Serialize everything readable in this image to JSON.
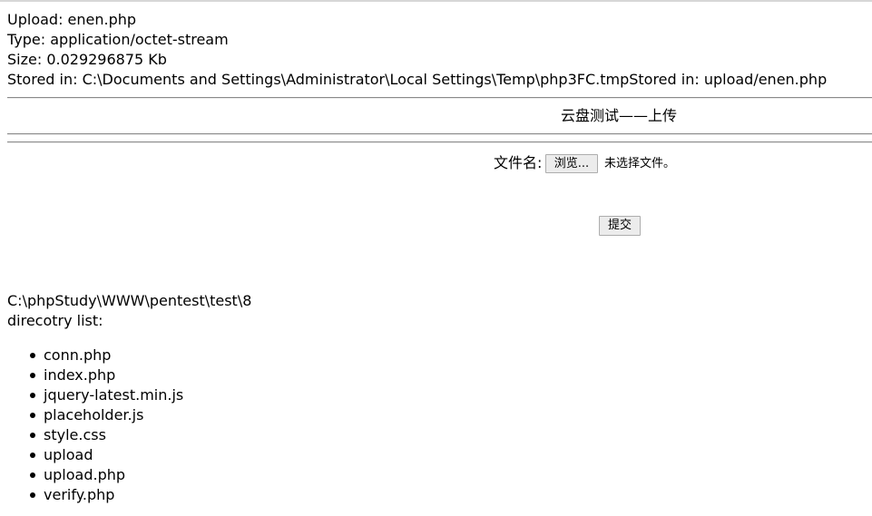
{
  "upload_info": {
    "upload_line": "Upload: enen.php",
    "type_line": "Type: application/octet-stream",
    "size_line": "Size: 0.029296875 Kb",
    "stored_line": "Stored in: C:\\Documents and Settings\\Administrator\\Local Settings\\Temp\\php3FC.tmpStored in: upload/enen.php"
  },
  "banner": {
    "title": "云盘测试——上传"
  },
  "upload_form": {
    "file_label": "文件名:",
    "browse_button": "浏览...",
    "no_file_text": "未选择文件。",
    "submit_button": "提交"
  },
  "directory": {
    "path": "C:\\phpStudy\\WWW\\pentest\\test\\8",
    "list_label": "direcotry list:",
    "files": [
      "conn.php",
      "index.php",
      "jquery-latest.min.js",
      "placeholder.js",
      "style.css",
      "upload",
      "upload.php",
      "verify.php"
    ]
  }
}
